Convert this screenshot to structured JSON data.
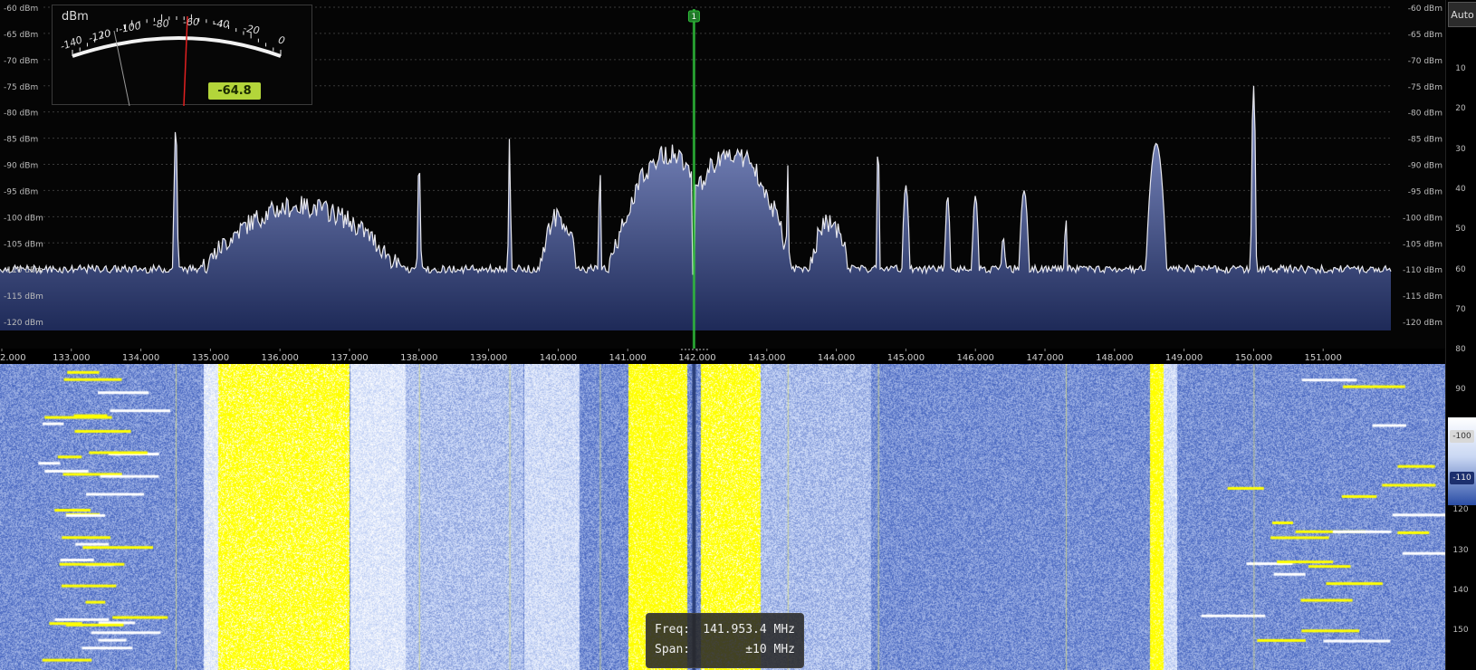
{
  "spectrum": {
    "y_unit": "dBm",
    "db_levels": [
      -60,
      -65,
      -70,
      -75,
      -80,
      -85,
      -90,
      -95,
      -100,
      -105,
      -110,
      -115,
      -120
    ],
    "db_label_suffix": " dBm",
    "freq_start_mhz": 132.0,
    "freq_end_mhz": 152.0,
    "freq_ticks": [
      "2.000",
      "133.000",
      "134.000",
      "135.000",
      "136.000",
      "137.000",
      "138.000",
      "139.000",
      "140.000",
      "141.000",
      "142.000",
      "143.000",
      "144.000",
      "145.000",
      "146.000",
      "147.000",
      "148.000",
      "149.000",
      "150.000",
      "151.000"
    ],
    "noise_floor_dbm": -110,
    "peaks_mhz": [
      134.5,
      138.0,
      139.3,
      140.6,
      141.6,
      142.5,
      143.3,
      144.6,
      145.0,
      145.6,
      146.0,
      146.4,
      146.7,
      147.3,
      148.6,
      150.0
    ],
    "colors": {
      "trace": "#e8e8ee",
      "fill_top": "#8090c8",
      "fill_bottom": "#1e2a58",
      "vfo": "#2fbf3a"
    }
  },
  "vfo": {
    "marker_label": "1",
    "freq_mhz": 141.9534
  },
  "smeter": {
    "unit_label": "dBm",
    "scale_labels": [
      "-140",
      "-120",
      "-100",
      "-80",
      "-60",
      "-40",
      "-20",
      "0"
    ],
    "value": "-64.8"
  },
  "right_scale": {
    "auto_label": "Auto",
    "labels": [
      "10",
      "20",
      "30",
      "40",
      "50",
      "60",
      "70",
      "80",
      "90",
      "100",
      "110",
      "120",
      "130",
      "140",
      "150"
    ],
    "slider_top": "-100",
    "slider_bottom": "-110"
  },
  "info": {
    "freq_label": "Freq:",
    "freq_value": "141.953.4 MHz",
    "span_label": "Span:",
    "span_value": "±10 MHz"
  },
  "waterfall": {
    "colors": {
      "low": "#3556b8",
      "mid": "#c9d7f7",
      "high": "#ffff00"
    }
  }
}
